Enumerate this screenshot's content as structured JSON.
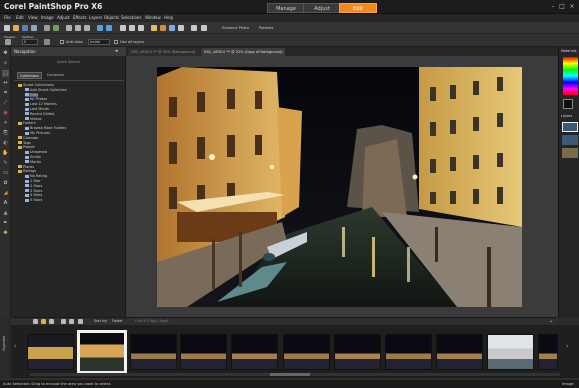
{
  "app": {
    "title": "Corel PaintShop Pro X6",
    "mode_tabs": [
      {
        "label": "Manage",
        "active": false
      },
      {
        "label": "Adjust",
        "active": false
      },
      {
        "label": "Edit",
        "active": true
      }
    ],
    "accent": "#f08a1c"
  },
  "menu": [
    "File",
    "Edit",
    "View",
    "Image",
    "Adjust",
    "Effects",
    "Layers",
    "Objects",
    "Selections",
    "Window",
    "Help"
  ],
  "toolbar": {
    "enhance_photo": "Enhance Photo",
    "palettes": "Palettes"
  },
  "tool_options": {
    "presets_label": "Presets:",
    "feather_label": "Feather:",
    "feather_value": "0",
    "antialias_label": "Anti-alias",
    "style_value": "Inside",
    "use_all_layers": "Use all layers"
  },
  "navigation": {
    "title": "Navigation",
    "quick_search": "Quick Search",
    "tabs": [
      "Collections",
      "Computer"
    ],
    "tree": [
      {
        "label": "Smart Collections",
        "level": 0
      },
      {
        "label": "Add Smart Collection",
        "level": 1
      },
      {
        "label": "Grey",
        "level": 1
      },
      {
        "label": "All Photos",
        "level": 1
      },
      {
        "label": "Last 12 Months",
        "level": 1
      },
      {
        "label": "Last Month",
        "level": 1
      },
      {
        "label": "Recent Edited",
        "level": 1
      },
      {
        "label": "Videos",
        "level": 1
      },
      {
        "label": "Folders",
        "level": 0
      },
      {
        "label": "Browse More Folders",
        "level": 1
      },
      {
        "label": "My Pictures",
        "level": 1
      },
      {
        "label": "Calendar",
        "level": 0
      },
      {
        "label": "Tags",
        "level": 0
      },
      {
        "label": "People",
        "level": 0
      },
      {
        "label": "Unnamed",
        "level": 1
      },
      {
        "label": "Emilio",
        "level": 1
      },
      {
        "label": "Martin",
        "level": 1
      },
      {
        "label": "Places",
        "level": 0
      },
      {
        "label": "Ratings",
        "level": 0
      },
      {
        "label": "No Rating",
        "level": 1
      },
      {
        "label": "1 Star",
        "level": 1
      },
      {
        "label": "2 Stars",
        "level": 1
      },
      {
        "label": "3 Stars",
        "level": 1
      },
      {
        "label": "4 Stars",
        "level": 1
      },
      {
        "label": "5 Stars",
        "level": 1
      }
    ]
  },
  "document_tabs": [
    {
      "label": "DSC_4635.0 ** @ 30% (Background)",
      "active": false
    },
    {
      "label": "DSC_4635.0 ** @ 22% (Copy of Background)",
      "active": true
    }
  ],
  "right_panel": {
    "materials": "Materials",
    "layers": "Layers"
  },
  "organizer": {
    "label": "Organizer",
    "sort_label": "Sort by:",
    "sort_value": "Folder",
    "filter_placeholder": "Find X-Y-Tags (Tags)"
  },
  "status": {
    "text": "Auto Selection: Drag to enclose the area you want to select.",
    "image_label": "Image:"
  }
}
